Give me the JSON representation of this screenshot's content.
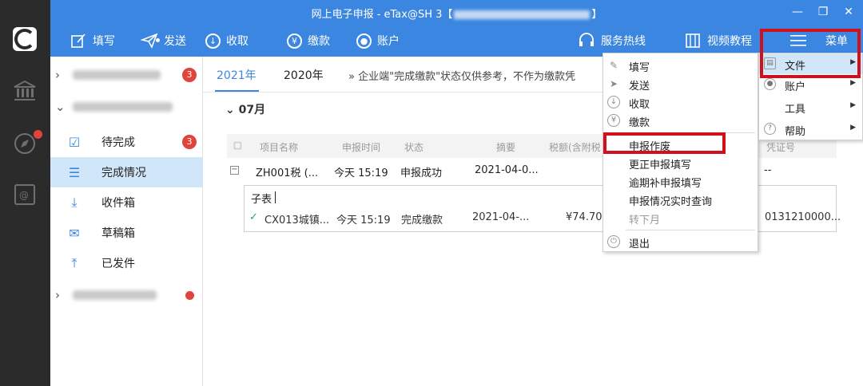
{
  "window": {
    "title_prefix": "网上电子申报 - eTax@SH 3【",
    "title_suffix": "】",
    "min_icon": "—",
    "max_icon": "❐",
    "close_icon": "✕"
  },
  "toolbar": {
    "fill": "填写",
    "send": "发送",
    "receive": "收取",
    "pay": "缴款",
    "account": "账户",
    "hotline": "服务热线",
    "video": "视频教程",
    "menu": "菜单"
  },
  "sidebar": {
    "group1_badge": "3",
    "items": [
      {
        "label": "待完成",
        "badge": "3",
        "icon": "clipboard-check-icon"
      },
      {
        "label": "完成情况",
        "icon": "list-icon"
      },
      {
        "label": "收件箱",
        "icon": "inbox-icon"
      },
      {
        "label": "草稿箱",
        "icon": "draft-icon"
      },
      {
        "label": "已发件",
        "icon": "upload-icon"
      }
    ]
  },
  "tabs": {
    "year1": "2021年",
    "year2": "2020年",
    "notice": "»  企业端\"完成缴款\"状态仅供参考，不作为缴款凭"
  },
  "month": "07月",
  "table": {
    "headers": [
      "项目名称",
      "申报时间",
      "状态",
      "摘要",
      "税额(含附税",
      "凭证号"
    ],
    "row1": {
      "expand": "−",
      "name": "ZH001税 (...",
      "time": "今天 15:19",
      "status": "申报成功",
      "summary": "2021-04-0...",
      "voucher": "--"
    },
    "subtable_title": "子表",
    "row2": {
      "check": "✓",
      "name": "CX013城镇...",
      "time": "今天 15:19",
      "status": "完成缴款",
      "summary": "2021-04-...",
      "amount": "¥74.70",
      "voucher": "0131210000..."
    }
  },
  "menu_main": {
    "items1": [
      "填写",
      "发送",
      "收取",
      "缴款"
    ],
    "items2": [
      "申报作废",
      "更正申报填写",
      "逾期补申报填写",
      "申报情况实时查询",
      "转下月"
    ],
    "exit": "退出"
  },
  "menu_right": {
    "file": "文件",
    "account": "账户",
    "tools": "工具",
    "help": "帮助"
  },
  "colors": {
    "accent": "#3b86e0",
    "highlight_red": "#d0111b",
    "badge_red": "#e0443a",
    "active_bg": "#d2e6fa"
  }
}
